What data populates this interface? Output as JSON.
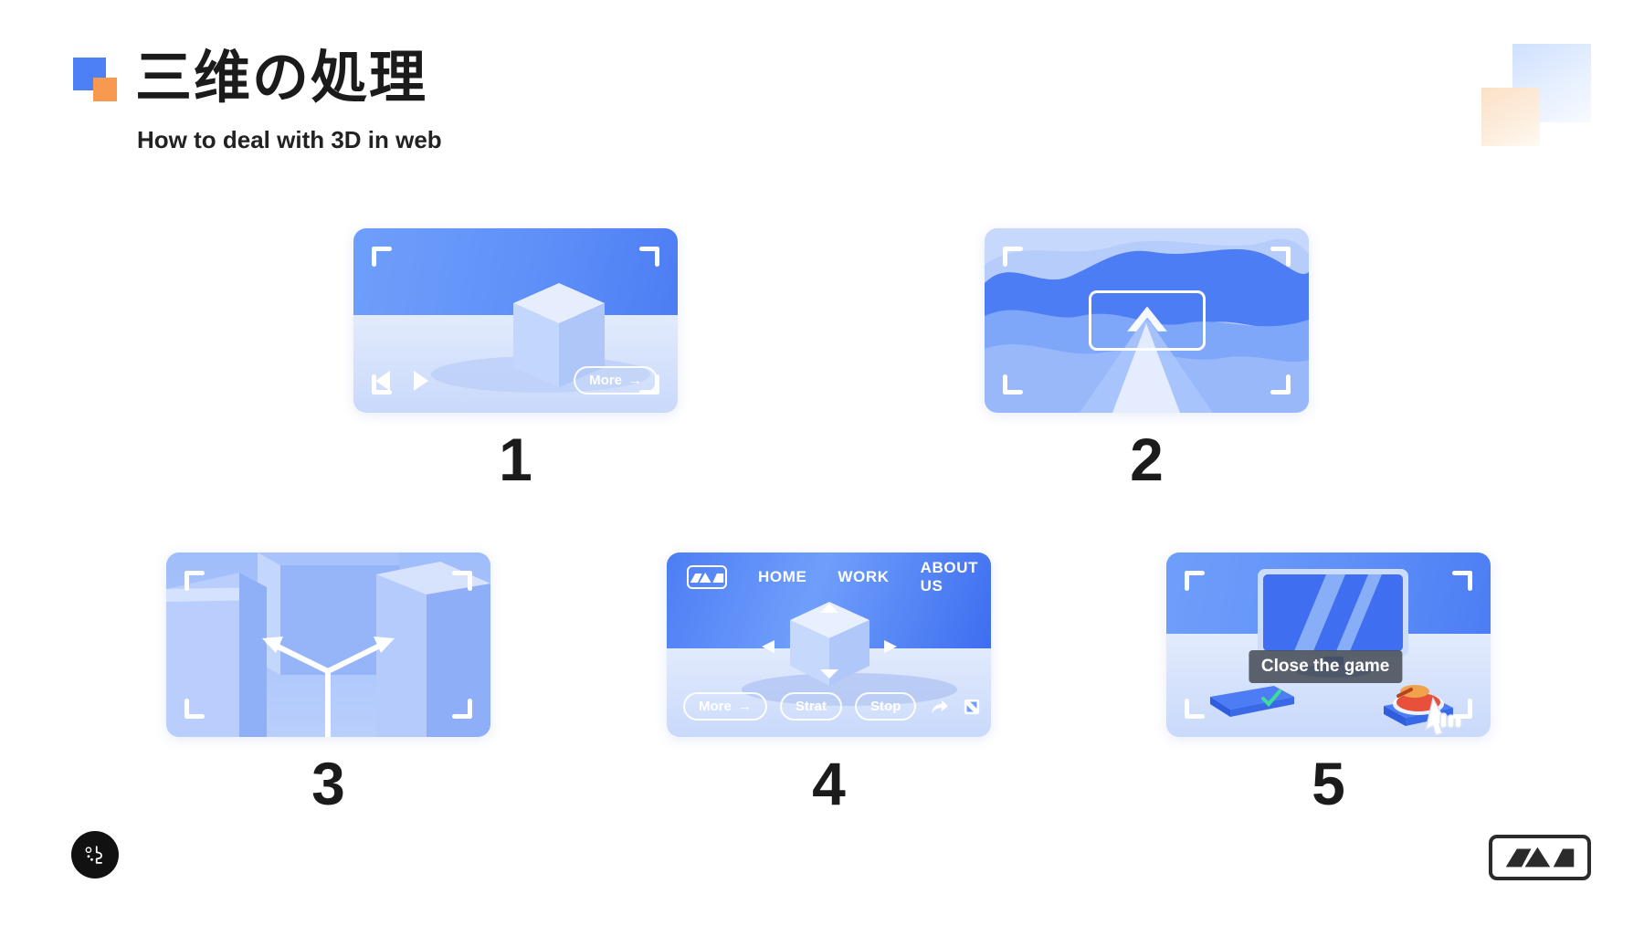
{
  "header": {
    "title": "三维の処理",
    "subtitle": "How to deal with 3D in web",
    "logo_blue_color": "#4d7ff5",
    "logo_orange_color": "#f79a50"
  },
  "cards": [
    {
      "number": "1",
      "name": "cube-viewer-card",
      "controls": {
        "prev": "prev-arrow",
        "next": "next-arrow",
        "more_label": "More",
        "more_arrow": "→"
      }
    },
    {
      "number": "2",
      "name": "terrain-upload-card",
      "controls": {
        "frame": "selection-frame",
        "arrow": "up-arrow"
      }
    },
    {
      "number": "3",
      "name": "axis-blocks-card",
      "controls": {
        "axis": "y-axis-arrows"
      }
    },
    {
      "number": "4",
      "name": "site-nav-cube-card",
      "nav": [
        {
          "label": "HOME"
        },
        {
          "label": "WORK"
        },
        {
          "label": "ABOUT US"
        }
      ],
      "buttons": [
        {
          "label": "More",
          "arrow": "→"
        },
        {
          "label": "Strat"
        },
        {
          "label": "Stop"
        }
      ],
      "icons": [
        "share-icon",
        "fullscreen-icon"
      ]
    },
    {
      "number": "5",
      "name": "desktop-game-card",
      "tooltip": "Close the game"
    }
  ],
  "footer": {
    "badge": "author-badge",
    "logo": "brand-logo"
  },
  "colors": {
    "sky": "#5f90f8",
    "ground": "#d6e2fc",
    "accent": "#4d7ff5",
    "text": "#1b1b1b"
  }
}
